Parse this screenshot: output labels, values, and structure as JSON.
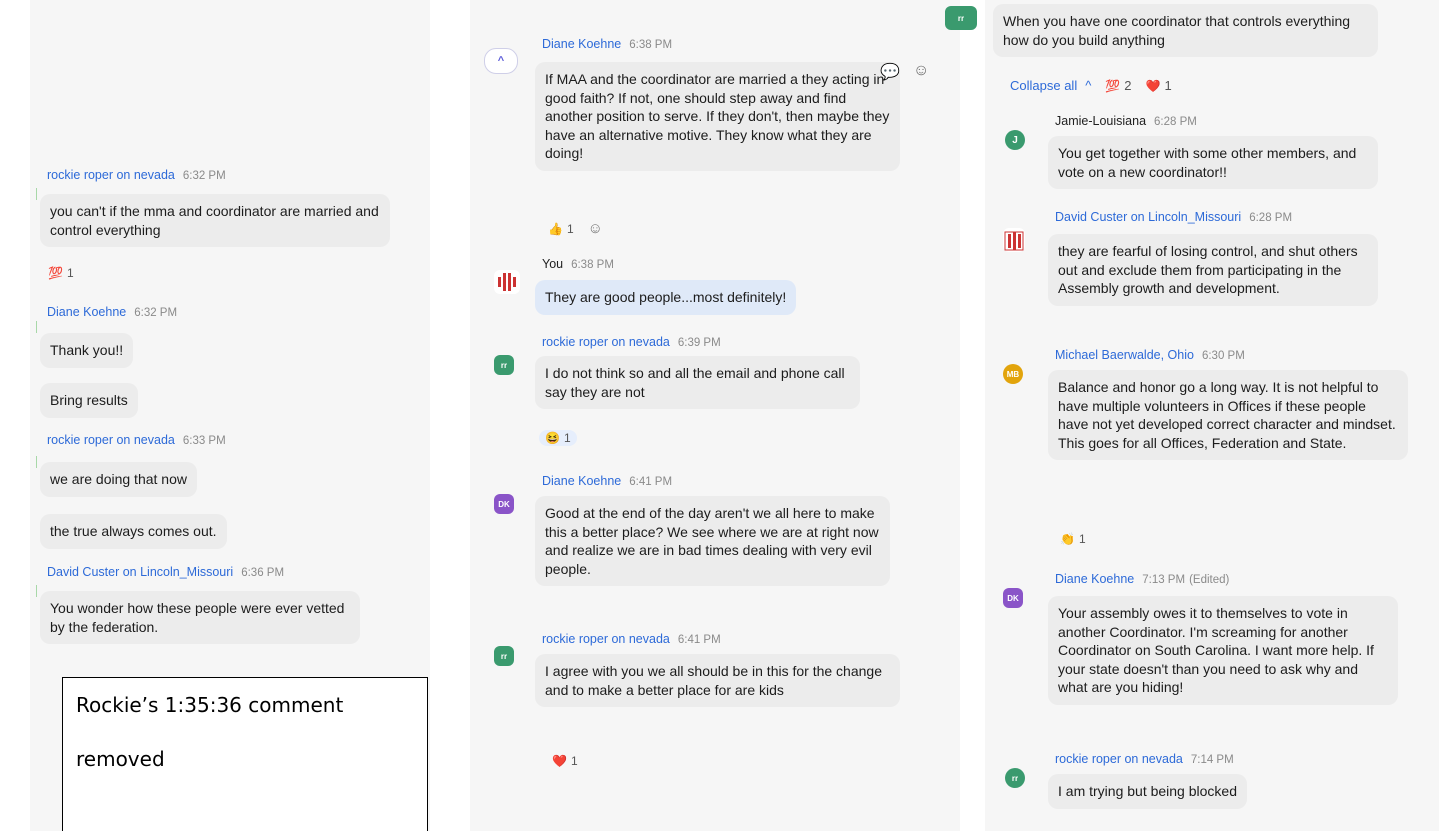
{
  "left": {
    "messages": [
      {
        "author": "rockie roper on nevada",
        "time": "6:32 PM",
        "text": "you can't if the mma and coordinator are married and control everything",
        "reaction": {
          "emoji": "💯",
          "count": "1"
        }
      },
      {
        "author": "Diane Koehne",
        "time": "6:32 PM",
        "text": "Thank you!!",
        "text2": "Bring results"
      },
      {
        "author": "rockie roper on nevada",
        "time": "6:33 PM",
        "text": "we are doing that now",
        "text2": "the true always comes out."
      },
      {
        "author": "David Custer on Lincoln_Missouri",
        "time": "6:36 PM",
        "text": "You wonder how these people were ever vetted by the federation."
      }
    ]
  },
  "note": {
    "line1": "Rockie’s 1:35:36 comment",
    "line2": "removed"
  },
  "middle": {
    "messages": [
      {
        "author": "Diane Koehne",
        "time": "6:38 PM",
        "text": "If MAA and the coordinator are married a they acting in good faith?  If not, one should step away and find another position to serve.  If they don't, then maybe they have an alternative motive. They know what they are doing!",
        "reaction": {
          "emoji": "👍",
          "count": "1"
        }
      },
      {
        "author": "You",
        "time": "6:38 PM",
        "text": "They are good people...most definitely!"
      },
      {
        "author": "rockie roper on nevada",
        "time": "6:39 PM",
        "avatar": "rr",
        "text": "I do not think so and all the email and phone call say they are not",
        "reaction": {
          "emoji": "😆",
          "count": "1"
        }
      },
      {
        "author": "Diane Koehne",
        "time": "6:41 PM",
        "avatar": "DK",
        "text": "Good at the end of the day aren't we all here to make this a better place? We see where we are at right now and realize we are in bad times dealing with very evil people."
      },
      {
        "author": "rockie roper on nevada",
        "time": "6:41 PM",
        "avatar": "rr",
        "text": "I agree with you we all should be in this for the change and to make a better place for are kids",
        "reaction": {
          "emoji": "❤️",
          "count": "1"
        }
      }
    ]
  },
  "right": {
    "top_avatar": "rr",
    "top_text": "When you have one coordinator that controls everything how do you build anything",
    "collapse": "Collapse all",
    "collapse_reactions": [
      {
        "emoji": "💯",
        "count": "2"
      },
      {
        "emoji": "❤️",
        "count": "1"
      }
    ],
    "messages": [
      {
        "author": "Jamie-Louisiana",
        "time": "6:28 PM",
        "avatar": "J",
        "text": "You get together with some other members, and vote on a new coordinator!!"
      },
      {
        "author": "David Custer on Lincoln_Missouri",
        "time": "6:28 PM",
        "text": "they are fearful of losing control, and shut others out and exclude them from participating in the Assembly growth and development."
      },
      {
        "author": "Michael Baerwalde, Ohio",
        "time": "6:30 PM",
        "avatar": "MB",
        "text": "Balance and honor go a long way. It is not helpful to have multiple volunteers in Offices if these people have not yet developed correct character and mindset. This goes for all Offices, Federation and State.",
        "reaction": {
          "emoji": "👏",
          "count": "1"
        }
      },
      {
        "author": "Diane Koehne",
        "time": "7:13 PM",
        "edited": "(Edited)",
        "avatar": "DK",
        "text": "Your assembly owes it to themselves to vote in another Coordinator.  I'm screaming for another Coordinator on South Carolina.  I want more help.  If your state doesn't than you need to ask why and what are you hiding!"
      },
      {
        "author": "rockie roper on nevada",
        "time": "7:14 PM",
        "avatar": "rr",
        "text": "I am trying but being blocked"
      }
    ]
  },
  "colors": {
    "name": "#2d6ad8",
    "bubble": "#ececec",
    "mine": "#dfe9f8"
  }
}
